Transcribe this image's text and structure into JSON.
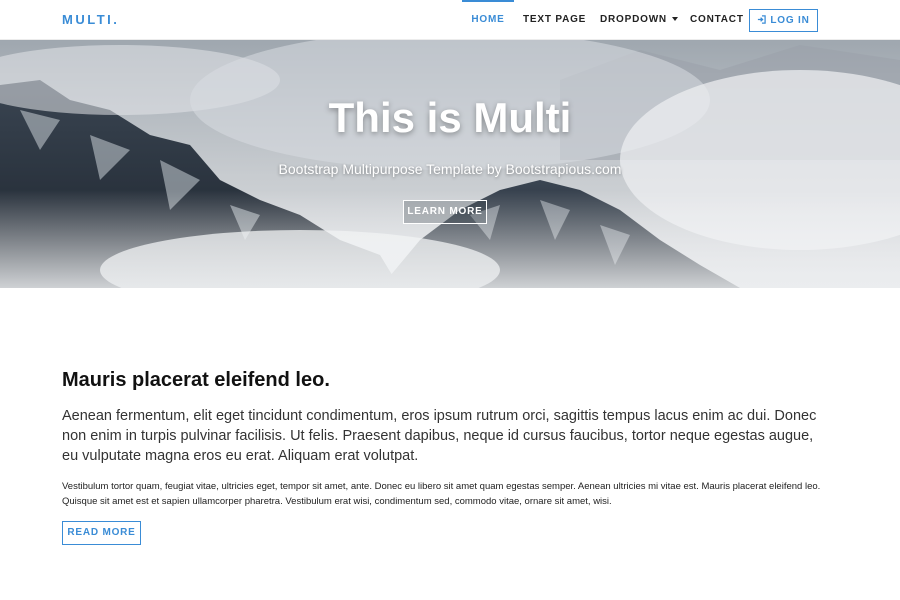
{
  "navbar": {
    "brand": "MULTI.",
    "items": [
      {
        "label": "HOME",
        "active": true
      },
      {
        "label": "TEXT PAGE"
      },
      {
        "label": "DROPDOWN"
      },
      {
        "label": "CONTACT"
      }
    ],
    "login_label": "LOG IN",
    "login_icon": "sign-in-icon"
  },
  "hero": {
    "title": "This is Multi",
    "subtitle": "Bootstrap Multipurpose Template by Bootstrapious.com",
    "button_label": "LEARN MORE"
  },
  "content": {
    "heading": "Mauris placerat eleifend leo.",
    "lead": "Aenean fermentum, elit eget tincidunt condimentum, eros ipsum rutrum orci, sagittis tempus lacus enim ac dui. Donec non enim in turpis pulvinar facilisis. Ut felis. Praesent dapibus, neque id cursus faucibus, tortor neque egestas augue, eu vulputate magna eros eu erat. Aliquam erat volutpat.",
    "body": "Vestibulum tortor quam, feugiat vitae, ultricies eget, tempor sit amet, ante. Donec eu libero sit amet quam egestas semper. Aenean ultricies mi vitae est. Mauris placerat eleifend leo. Quisque sit amet est et sapien ullamcorper pharetra. Vestibulum erat wisi, condimentum sed, commodo vitae, ornare sit amet, wisi.",
    "button_label": "READ MORE"
  },
  "colors": {
    "accent": "#3a8cd6",
    "text": "#222222"
  }
}
